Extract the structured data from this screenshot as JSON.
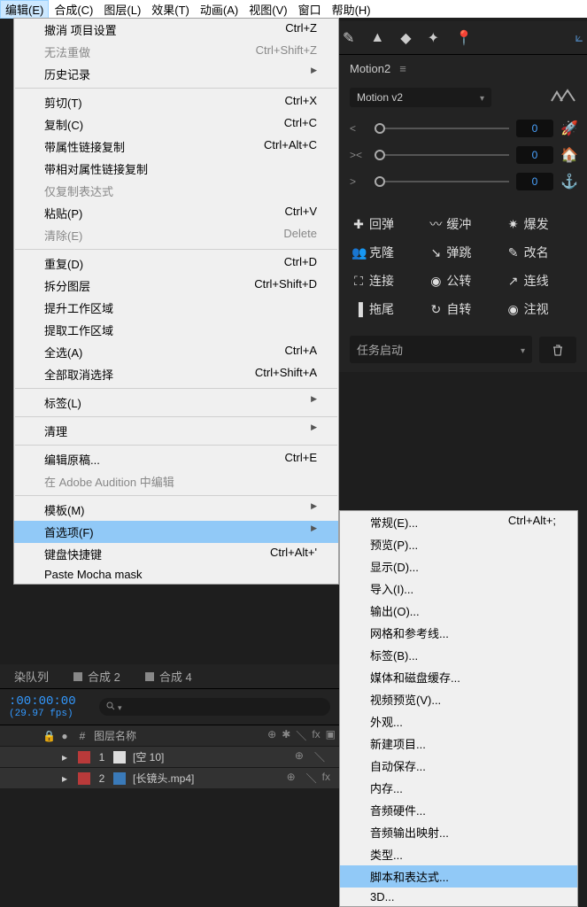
{
  "menubar": [
    "编辑(E)",
    "合成(C)",
    "图层(L)",
    "效果(T)",
    "动画(A)",
    "视图(V)",
    "窗口",
    "帮助(H)"
  ],
  "dropdown": [
    {
      "label": "撤消 项目设置",
      "shortcut": "Ctrl+Z"
    },
    {
      "label": "无法重做",
      "shortcut": "Ctrl+Shift+Z",
      "disabled": true
    },
    {
      "label": "历史记录",
      "arrow": true
    },
    {
      "sep": true
    },
    {
      "label": "剪切(T)",
      "shortcut": "Ctrl+X"
    },
    {
      "label": "复制(C)",
      "shortcut": "Ctrl+C"
    },
    {
      "label": "带属性链接复制",
      "shortcut": "Ctrl+Alt+C"
    },
    {
      "label": "带相对属性链接复制"
    },
    {
      "label": "仅复制表达式",
      "disabled": true
    },
    {
      "label": "粘贴(P)",
      "shortcut": "Ctrl+V"
    },
    {
      "label": "清除(E)",
      "shortcut": "Delete",
      "disabled": true
    },
    {
      "sep": true
    },
    {
      "label": "重复(D)",
      "shortcut": "Ctrl+D"
    },
    {
      "label": "拆分图层",
      "shortcut": "Ctrl+Shift+D"
    },
    {
      "label": "提升工作区域"
    },
    {
      "label": "提取工作区域"
    },
    {
      "label": "全选(A)",
      "shortcut": "Ctrl+A"
    },
    {
      "label": "全部取消选择",
      "shortcut": "Ctrl+Shift+A"
    },
    {
      "sep": true
    },
    {
      "label": "标签(L)",
      "arrow": true
    },
    {
      "sep": true
    },
    {
      "label": "清理",
      "arrow": true
    },
    {
      "sep": true
    },
    {
      "label": "编辑原稿...",
      "shortcut": "Ctrl+E"
    },
    {
      "label": "在 Adobe Audition 中编辑",
      "disabled": true
    },
    {
      "sep": true
    },
    {
      "label": "模板(M)",
      "arrow": true
    },
    {
      "label": "首选项(F)",
      "arrow": true,
      "highlighted": true
    },
    {
      "label": "键盘快捷键",
      "shortcut": "Ctrl+Alt+'"
    },
    {
      "label": "Paste Mocha mask"
    }
  ],
  "submenu": [
    {
      "label": "常规(E)...",
      "shortcut": "Ctrl+Alt+;"
    },
    {
      "label": "预览(P)..."
    },
    {
      "label": "显示(D)..."
    },
    {
      "label": "导入(I)..."
    },
    {
      "label": "输出(O)..."
    },
    {
      "label": "网格和参考线..."
    },
    {
      "label": "标签(B)..."
    },
    {
      "label": "媒体和磁盘缓存..."
    },
    {
      "label": "视频预览(V)..."
    },
    {
      "label": "外观..."
    },
    {
      "label": "新建项目..."
    },
    {
      "label": "自动保存..."
    },
    {
      "label": "内存..."
    },
    {
      "label": "音频硬件..."
    },
    {
      "label": "音频输出映射..."
    },
    {
      "label": "类型..."
    },
    {
      "label": "脚本和表达式...",
      "highlighted": true
    },
    {
      "label": "3D..."
    }
  ],
  "panel": {
    "title": "Motion2",
    "version": "Motion v2",
    "sliders": [
      {
        "handle": "<",
        "value": "0",
        "icon": "rocket"
      },
      {
        "handle": "><",
        "value": "0",
        "icon": "house"
      },
      {
        "handle": ">",
        "value": "0",
        "icon": "anchor"
      }
    ],
    "actions": [
      {
        "icon": "plus",
        "label": "回弹"
      },
      {
        "icon": "wave",
        "label": "缓冲"
      },
      {
        "icon": "burst",
        "label": "爆发"
      },
      {
        "icon": "people",
        "label": "克隆"
      },
      {
        "icon": "bounce",
        "label": "弹跳"
      },
      {
        "icon": "pencil",
        "label": "改名"
      },
      {
        "icon": "link",
        "label": "连接"
      },
      {
        "icon": "orbit",
        "label": "公转"
      },
      {
        "icon": "linkarrow",
        "label": "连线"
      },
      {
        "icon": "trail",
        "label": "拖尾"
      },
      {
        "icon": "rotate",
        "label": "自转"
      },
      {
        "icon": "eye",
        "label": "注视"
      }
    ],
    "task": "任务启动"
  },
  "timeline": {
    "tabs": [
      "染队列",
      "合成 2",
      "合成 4"
    ],
    "timecode": ":00:00:00",
    "fps": "(29.97 fps)",
    "header_name": "图层名称",
    "layers": [
      {
        "num": "1",
        "color": "red",
        "chip2": "white",
        "name": "[空 10]"
      },
      {
        "num": "2",
        "color": "red",
        "chip2": "blue",
        "name": "[长镜头.mp4]"
      }
    ]
  }
}
